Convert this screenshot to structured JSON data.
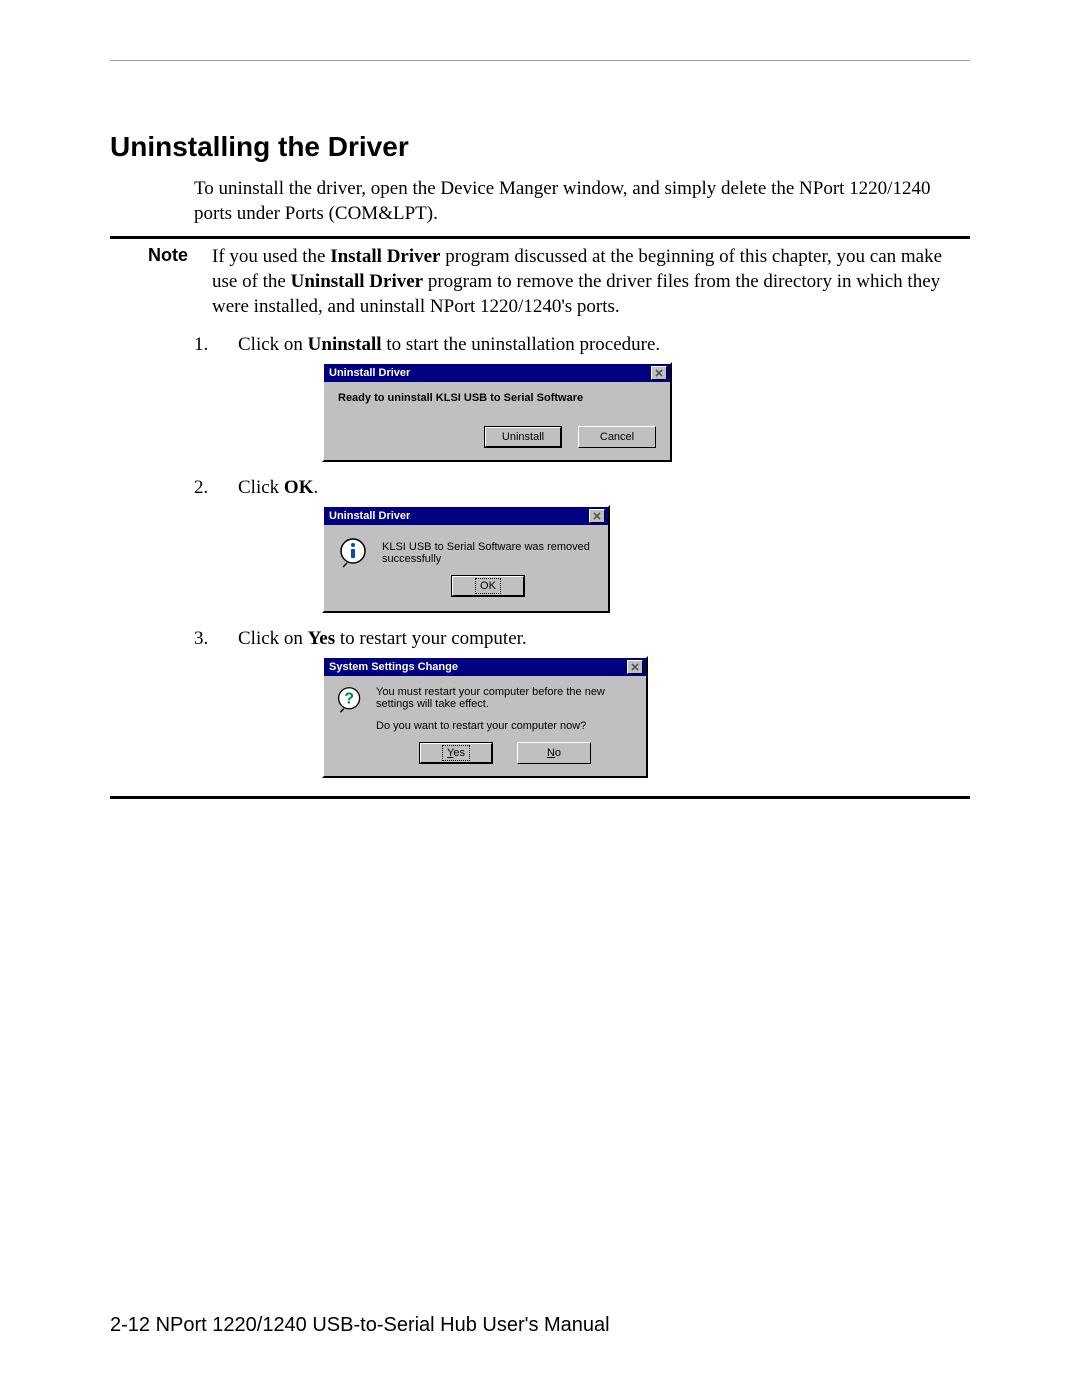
{
  "section_title": "Uninstalling the Driver",
  "intro": "To uninstall the driver, open the Device Manger window, and simply delete the NPort 1220/1240 ports under Ports (COM&LPT).",
  "note_label": "Note",
  "note_body_parts": {
    "p1": "If you used the ",
    "b1": "Install Driver",
    "p2": " program discussed at the beginning of this chapter, you can make use of the ",
    "b2": "Uninstall Driver",
    "p3": " program to remove the driver files from the directory in which they were installed, and uninstall NPort 1220/1240's ports."
  },
  "steps": [
    {
      "num": "1.",
      "pre": "Click on ",
      "bold": "Uninstall",
      "post": " to start the uninstallation procedure."
    },
    {
      "num": "2.",
      "pre": "Click ",
      "bold": "OK",
      "post": "."
    },
    {
      "num": "3.",
      "pre": "Click on ",
      "bold": "Yes",
      "post": " to restart your computer."
    }
  ],
  "dlg1": {
    "title": "Uninstall Driver",
    "message": "Ready to uninstall KLSI USB to Serial Software",
    "btn_uninstall": "Uninstall",
    "btn_cancel": "Cancel"
  },
  "dlg2": {
    "title": "Uninstall Driver",
    "message": "KLSI USB to Serial Software was removed successfully",
    "btn_ok": "OK"
  },
  "dlg3": {
    "title": "System Settings Change",
    "line1": "You must restart your computer before the new settings will take effect.",
    "line2": "Do you want to restart your computer now?",
    "btn_yes": "Yes",
    "btn_no": "No"
  },
  "footer": "2-12  NPort 1220/1240 USB-to-Serial Hub User's Manual"
}
